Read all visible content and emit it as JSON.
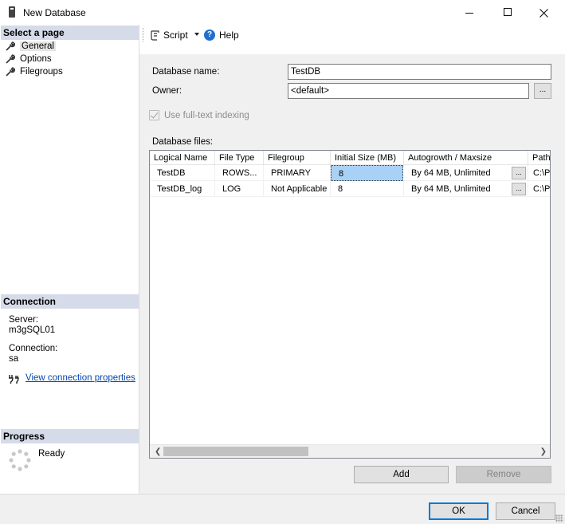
{
  "window": {
    "title": "New Database",
    "controls": [
      "minimize",
      "maximize",
      "close"
    ]
  },
  "left_pane": {
    "select_page_header": "Select a page",
    "pages": [
      {
        "label": "General",
        "selected": true,
        "icon": "wrench-icon"
      },
      {
        "label": "Options",
        "selected": false,
        "icon": "wrench-icon"
      },
      {
        "label": "Filegroups",
        "selected": false,
        "icon": "wrench-icon"
      }
    ],
    "connection_header": "Connection",
    "server_label": "Server:",
    "server_value": "m3gSQL01",
    "connection_label": "Connection:",
    "connection_value": "sa",
    "view_connection_link": "View connection properties",
    "progress_header": "Progress",
    "progress_status": "Ready"
  },
  "toolbar": {
    "script_label": "Script",
    "help_label": "Help"
  },
  "form": {
    "database_name_label": "Database name:",
    "database_name_value": "TestDB",
    "owner_label": "Owner:",
    "owner_value": "<default>",
    "owner_browse": "...",
    "fulltext_label": "Use full-text indexing",
    "fulltext_checked": true,
    "fulltext_disabled": true,
    "files_label": "Database files:"
  },
  "files_grid": {
    "columns": [
      "Logical Name",
      "File Type",
      "Filegroup",
      "Initial Size (MB)",
      "Autogrowth / Maxsize",
      "Path"
    ],
    "rows": [
      {
        "logical_name": "TestDB",
        "file_type": "ROWS...",
        "filegroup": "PRIMARY",
        "initial_size": "8",
        "autogrowth": "By 64 MB, Unlimited",
        "browse": "...",
        "path": "C:\\P"
      },
      {
        "logical_name": "TestDB_log",
        "file_type": "LOG",
        "filegroup": "Not Applicable",
        "initial_size": "8",
        "autogrowth": "By 64 MB, Unlimited",
        "browse": "...",
        "path": "C:\\P"
      }
    ],
    "selected_cell": "rows.0.initial_size"
  },
  "buttons": {
    "add": "Add",
    "remove": "Remove",
    "ok": "OK",
    "cancel": "Cancel"
  },
  "colors": {
    "section_header_bg": "#d6dbe9",
    "selected_cell_bg": "#a8d1f5",
    "link": "#0645ad",
    "help_icon": "#1e6fd0",
    "default_button_border": "#0078d7"
  }
}
